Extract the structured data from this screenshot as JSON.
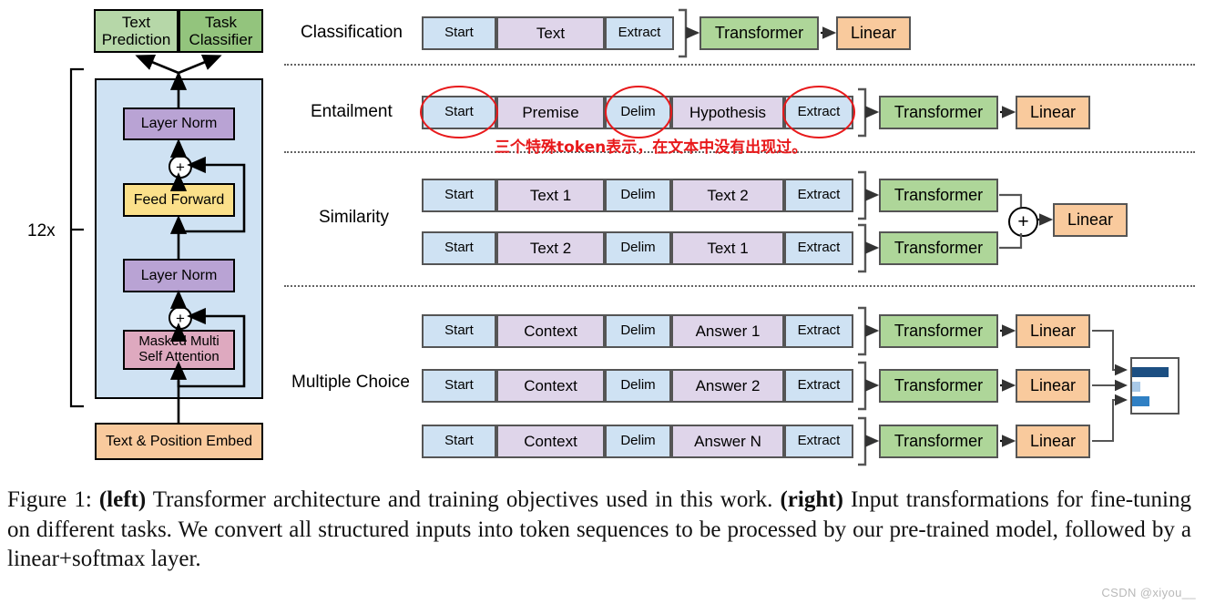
{
  "figure": {
    "caption_prefix": "Figure 1:",
    "caption_left_tag": "(left)",
    "caption_part1": " Transformer architecture and training objectives used in this work. ",
    "caption_right_tag": "(right)",
    "caption_part2": " Input transformations for fine-tuning on different tasks. We convert all structured inputs into token sequences to be processed by our pre-trained model, followed by a linear+softmax layer.",
    "watermark": "CSDN @xiyou__"
  },
  "architecture": {
    "heads": [
      {
        "label": "Text\nPrediction",
        "color": "#b6d7a8"
      },
      {
        "label": "Task\nClassifier",
        "color": "#93c47d"
      }
    ],
    "repeat_label": "12x",
    "blocks": [
      {
        "label": "Layer Norm",
        "color": "#b9a3d4"
      },
      {
        "label": "Feed Forward",
        "color": "#fbe08a"
      },
      {
        "label": "Layer Norm",
        "color": "#b9a3d4"
      },
      {
        "label": "Masked Multi\nSelf Attention",
        "color": "#dea9bf"
      }
    ],
    "embed": {
      "label": "Text & Position Embed",
      "color": "#f9ca9d"
    },
    "add_symbol": "+",
    "stack_background": "#cfe2f3"
  },
  "tasks": [
    {
      "name": "Classification",
      "sequences": [
        {
          "tokens": [
            {
              "label": "Start",
              "kind": "special"
            },
            {
              "label": "Text",
              "kind": "content"
            },
            {
              "label": "Extract",
              "kind": "special"
            }
          ]
        }
      ],
      "transformers": [
        "Transformer"
      ],
      "linears": [
        "Linear"
      ]
    },
    {
      "name": "Entailment",
      "sequences": [
        {
          "tokens": [
            {
              "label": "Start",
              "kind": "special"
            },
            {
              "label": "Premise",
              "kind": "content"
            },
            {
              "label": "Delim",
              "kind": "special"
            },
            {
              "label": "Hypothesis",
              "kind": "content"
            },
            {
              "label": "Extract",
              "kind": "special"
            }
          ]
        }
      ],
      "transformers": [
        "Transformer"
      ],
      "linears": [
        "Linear"
      ],
      "annotation": "三个特殊token表示，在文本中没有出现过。"
    },
    {
      "name": "Similarity",
      "sequences": [
        {
          "tokens": [
            {
              "label": "Start",
              "kind": "special"
            },
            {
              "label": "Text 1",
              "kind": "content"
            },
            {
              "label": "Delim",
              "kind": "special"
            },
            {
              "label": "Text 2",
              "kind": "content"
            },
            {
              "label": "Extract",
              "kind": "special"
            }
          ]
        },
        {
          "tokens": [
            {
              "label": "Start",
              "kind": "special"
            },
            {
              "label": "Text 2",
              "kind": "content"
            },
            {
              "label": "Delim",
              "kind": "special"
            },
            {
              "label": "Text 1",
              "kind": "content"
            },
            {
              "label": "Extract",
              "kind": "special"
            }
          ]
        }
      ],
      "transformers": [
        "Transformer",
        "Transformer"
      ],
      "linears": [
        "Linear"
      ],
      "combiner": "+"
    },
    {
      "name": "Multiple Choice",
      "sequences": [
        {
          "tokens": [
            {
              "label": "Start",
              "kind": "special"
            },
            {
              "label": "Context",
              "kind": "content"
            },
            {
              "label": "Delim",
              "kind": "special"
            },
            {
              "label": "Answer 1",
              "kind": "content"
            },
            {
              "label": "Extract",
              "kind": "special"
            }
          ]
        },
        {
          "tokens": [
            {
              "label": "Start",
              "kind": "special"
            },
            {
              "label": "Context",
              "kind": "content"
            },
            {
              "label": "Delim",
              "kind": "special"
            },
            {
              "label": "Answer 2",
              "kind": "content"
            },
            {
              "label": "Extract",
              "kind": "special"
            }
          ]
        },
        {
          "tokens": [
            {
              "label": "Start",
              "kind": "special"
            },
            {
              "label": "Context",
              "kind": "content"
            },
            {
              "label": "Delim",
              "kind": "special"
            },
            {
              "label": "Answer N",
              "kind": "content"
            },
            {
              "label": "Extract",
              "kind": "special"
            }
          ]
        }
      ],
      "transformers": [
        "Transformer",
        "Transformer",
        "Transformer"
      ],
      "linears": [
        "Linear",
        "Linear",
        "Linear"
      ],
      "softmax_chart": {
        "bars": [
          {
            "value": 0.78,
            "color": "#1c4f82"
          },
          {
            "value": 0.12,
            "color": "#a9c9e8"
          },
          {
            "value": 0.35,
            "color": "#3080c4"
          }
        ]
      }
    }
  ],
  "colors": {
    "special_token": "#cfe2f3",
    "content_token": "#dfd5ea",
    "transformer": "#aed699",
    "linear": "#f9ca9d",
    "annotation_red": "#e8191b",
    "stack_blue": "#cfe2f3"
  }
}
